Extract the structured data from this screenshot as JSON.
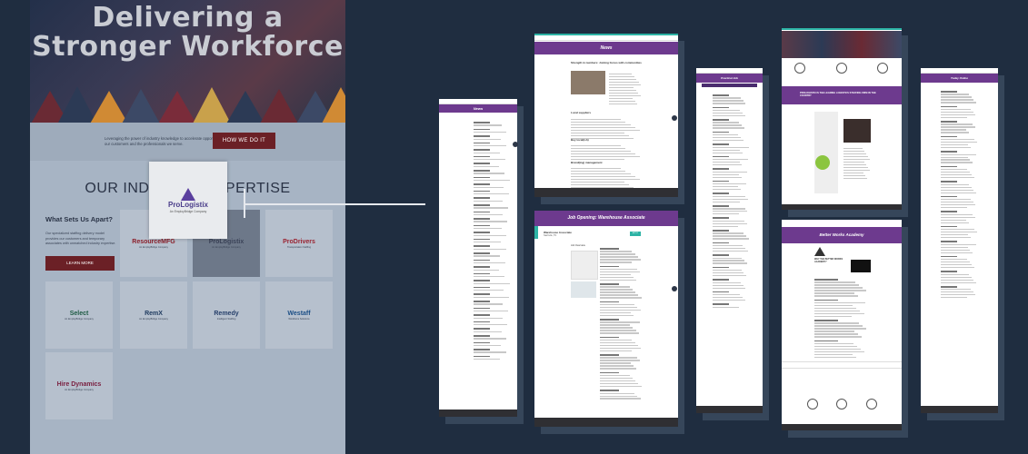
{
  "hero": {
    "title": "Delivering a Stronger Workforce"
  },
  "intro": {
    "text": "Leveraging the power of industry knowledge to accelerate opportunities for our customers and the professionals we serve.",
    "cta": "HOW WE DO IT"
  },
  "expertise": {
    "title": "OUR INDUSTRY EXPERTISE",
    "why_title": "What Sets Us Apart?",
    "why_text": "Our specialized staffing delivery model provides our customers and temporary associates with unmatched industry expertise.",
    "learn_more": "LEARN MORE",
    "brands": [
      {
        "name": "ResourceMFG",
        "sub": "An EmployBridge Company"
      },
      {
        "name": "ProLogistix",
        "sub": "An EmployBridge Company"
      },
      {
        "name": "ProDrivers",
        "sub": "Transportation Staffing"
      },
      {
        "name": "Select",
        "sub": "An EmployBridge Company"
      },
      {
        "name": "RemX",
        "sub": "An EmployBridge Company"
      },
      {
        "name": "Remedy",
        "sub": "Intelligent Staffing"
      },
      {
        "name": "Westaff",
        "sub": "Workforce Solutions"
      },
      {
        "name": "Hire Dynamics",
        "sub": "An EmployBridge Company"
      }
    ]
  },
  "popup": {
    "name": "ProLogistix",
    "sub": "An EmployBridge Company"
  },
  "pages": {
    "news": "News",
    "news_article_title": "Strength in numbers: Joining forces with communities",
    "local": "Local suppliers",
    "buy": "Buy local(ish)",
    "brand_mgmt": "Brand(ing) management",
    "job": "Job Opening: Warehouse Associate",
    "job_subtitle": "Warehouse Associate",
    "job_location": "Nashville, TN",
    "job_overview": "Job Overview",
    "job_apply": "APPLY",
    "portal": "Practical Job",
    "leading": "PROLOGISTIX IS THE LEADING LOGISTICS STAFFING FIRM IN THE COUNTRY",
    "today": "Today Online",
    "bw": "Better Works Academy",
    "bw_question": "WHY THE BETTER WORKS ACADEMY?"
  },
  "colors": {
    "accent": "#6d3a8e",
    "cta": "#6b2026",
    "bg": "#1f2d40"
  }
}
